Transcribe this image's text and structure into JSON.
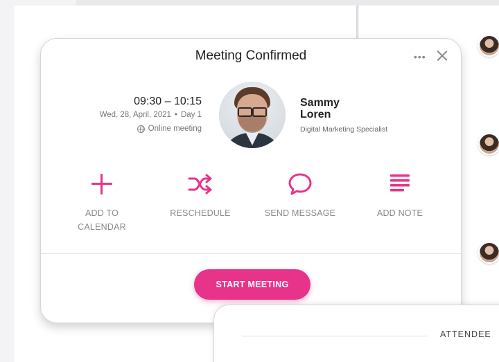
{
  "card": {
    "title": "Meeting Confirmed",
    "more_label": "•••",
    "time": "09:30 – 10:15",
    "date": "Wed, 28, April, 2021",
    "date_sep": "•",
    "day": "Day 1",
    "location": "Online meeting",
    "person": {
      "first_name": "Sammy",
      "last_name": "Loren",
      "role": "Digital Marketing Specialist"
    },
    "actions": [
      {
        "label_line1": "ADD TO",
        "label_line2": "CALENDAR",
        "icon": "plus-icon"
      },
      {
        "label_line1": "RESCHEDULE",
        "icon": "shuffle-icon"
      },
      {
        "label_line1": "SEND MESSAGE",
        "icon": "chat-bubble-icon"
      },
      {
        "label_line1": "ADD NOTE",
        "icon": "note-lines-icon"
      }
    ],
    "start_button": "START MEETING"
  },
  "attendees_card": {
    "label": "ATTENDEE"
  },
  "colors": {
    "accent": "#e8338a",
    "text": "#222222",
    "muted": "#8a8a8a"
  }
}
